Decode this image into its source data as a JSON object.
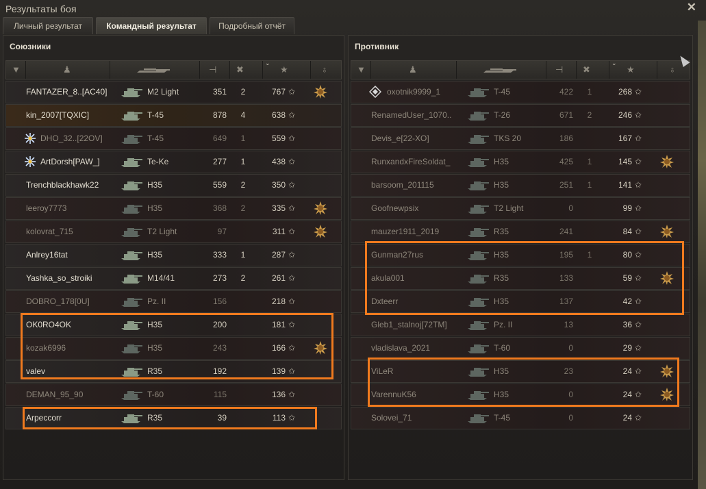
{
  "window": {
    "title": "Результаты боя",
    "close_label": "✕"
  },
  "tabs": [
    {
      "label": "Личный результат",
      "active": false
    },
    {
      "label": "Командный результат",
      "active": true
    },
    {
      "label": "Подробный отчёт",
      "active": false
    }
  ],
  "allies": {
    "title": "Союзники",
    "rows": [
      {
        "name": "FANTAZER_8..[AC40]",
        "vehicle": "M2 Light",
        "damage": "351",
        "kills": "2",
        "xp": "767",
        "alive": true,
        "medal": true,
        "badge": "",
        "player": false
      },
      {
        "name": "kin_2007[TQXIC]",
        "vehicle": "T-45",
        "damage": "878",
        "kills": "4",
        "xp": "638",
        "alive": true,
        "medal": false,
        "badge": "",
        "player": true
      },
      {
        "name": "DHO_32..[22OV]",
        "vehicle": "T-45",
        "damage": "649",
        "kills": "1",
        "xp": "559",
        "alive": false,
        "medal": false,
        "badge": "snowflake",
        "player": false
      },
      {
        "name": "ArtDorsh[PAW_]",
        "vehicle": "Te-Ke",
        "damage": "277",
        "kills": "1",
        "xp": "438",
        "alive": true,
        "medal": false,
        "badge": "snowflake",
        "player": false
      },
      {
        "name": "Trenchblackhawk22",
        "vehicle": "H35",
        "damage": "559",
        "kills": "2",
        "xp": "350",
        "alive": true,
        "medal": false,
        "badge": "",
        "player": false
      },
      {
        "name": "leeroy7773",
        "vehicle": "H35",
        "damage": "368",
        "kills": "2",
        "xp": "335",
        "alive": false,
        "medal": true,
        "badge": "",
        "player": false
      },
      {
        "name": "kolovrat_715",
        "vehicle": "T2 Light",
        "damage": "97",
        "kills": "",
        "xp": "311",
        "alive": false,
        "medal": true,
        "badge": "",
        "player": false
      },
      {
        "name": "Anlrey16tat",
        "vehicle": "H35",
        "damage": "333",
        "kills": "1",
        "xp": "287",
        "alive": true,
        "medal": false,
        "badge": "",
        "player": false
      },
      {
        "name": "Yashka_so_stroiki",
        "vehicle": "M14/41",
        "damage": "273",
        "kills": "2",
        "xp": "261",
        "alive": true,
        "medal": false,
        "badge": "",
        "player": false
      },
      {
        "name": "DOBRO_178[0U]",
        "vehicle": "Pz. II",
        "damage": "156",
        "kills": "",
        "xp": "218",
        "alive": false,
        "medal": false,
        "badge": "",
        "player": false
      },
      {
        "name": "OK0RO4OK",
        "vehicle": "H35",
        "damage": "200",
        "kills": "",
        "xp": "181",
        "alive": true,
        "medal": false,
        "badge": "",
        "player": false
      },
      {
        "name": "kozak6996",
        "vehicle": "H35",
        "damage": "243",
        "kills": "",
        "xp": "166",
        "alive": false,
        "medal": true,
        "badge": "",
        "player": false
      },
      {
        "name": "valev",
        "vehicle": "R35",
        "damage": "192",
        "kills": "",
        "xp": "139",
        "alive": true,
        "medal": false,
        "badge": "",
        "player": false
      },
      {
        "name": "DEMAN_95_90",
        "vehicle": "T-60",
        "damage": "115",
        "kills": "",
        "xp": "136",
        "alive": false,
        "medal": false,
        "badge": "",
        "player": false
      },
      {
        "name": "Arpeccorr",
        "vehicle": "R35",
        "damage": "39",
        "kills": "",
        "xp": "113",
        "alive": true,
        "medal": false,
        "badge": "",
        "player": false
      }
    ]
  },
  "enemies": {
    "title": "Противник",
    "rows": [
      {
        "name": "oxotnik9999_1",
        "vehicle": "T-45",
        "damage": "422",
        "kills": "1",
        "xp": "268",
        "alive": false,
        "medal": false,
        "badge": "diamond"
      },
      {
        "name": "RenamedUser_1070..",
        "vehicle": "T-26",
        "damage": "671",
        "kills": "2",
        "xp": "246",
        "alive": false,
        "medal": false,
        "badge": ""
      },
      {
        "name": "Devis_e[22-XO]",
        "vehicle": "TKS 20",
        "damage": "186",
        "kills": "",
        "xp": "167",
        "alive": false,
        "medal": false,
        "badge": ""
      },
      {
        "name": "RunxandxFireSoldat_",
        "vehicle": "H35",
        "damage": "425",
        "kills": "1",
        "xp": "145",
        "alive": false,
        "medal": true,
        "badge": ""
      },
      {
        "name": "barsoom_201115",
        "vehicle": "H35",
        "damage": "251",
        "kills": "1",
        "xp": "141",
        "alive": false,
        "medal": false,
        "badge": ""
      },
      {
        "name": "Goofnewpsix",
        "vehicle": "T2 Light",
        "damage": "0",
        "kills": "",
        "xp": "99",
        "alive": false,
        "medal": false,
        "badge": ""
      },
      {
        "name": "mauzer1911_2019",
        "vehicle": "R35",
        "damage": "241",
        "kills": "",
        "xp": "84",
        "alive": false,
        "medal": true,
        "badge": ""
      },
      {
        "name": "Gunman27rus",
        "vehicle": "H35",
        "damage": "195",
        "kills": "1",
        "xp": "80",
        "alive": false,
        "medal": false,
        "badge": ""
      },
      {
        "name": "akula001",
        "vehicle": "R35",
        "damage": "133",
        "kills": "",
        "xp": "59",
        "alive": false,
        "medal": true,
        "badge": ""
      },
      {
        "name": "Dxteerr",
        "vehicle": "H35",
        "damage": "137",
        "kills": "",
        "xp": "42",
        "alive": false,
        "medal": false,
        "badge": ""
      },
      {
        "name": "Gleb1_stalnoj[72TM]",
        "vehicle": "Pz. II",
        "damage": "13",
        "kills": "",
        "xp": "36",
        "alive": false,
        "medal": false,
        "badge": ""
      },
      {
        "name": "vladislava_2021",
        "vehicle": "T-60",
        "damage": "0",
        "kills": "",
        "xp": "29",
        "alive": false,
        "medal": false,
        "badge": ""
      },
      {
        "name": "ViLeR",
        "vehicle": "H35",
        "damage": "23",
        "kills": "",
        "xp": "24",
        "alive": false,
        "medal": true,
        "badge": ""
      },
      {
        "name": "VarennuK56",
        "vehicle": "H35",
        "damage": "0",
        "kills": "",
        "xp": "24",
        "alive": false,
        "medal": true,
        "badge": ""
      },
      {
        "name": "Solovei_71",
        "vehicle": "T-45",
        "damage": "0",
        "kills": "",
        "xp": "24",
        "alive": false,
        "medal": false,
        "badge": ""
      }
    ]
  },
  "columns": {
    "icons": [
      "platoon-icon",
      "player-icon",
      "tank-icon",
      "damage-icon",
      "kills-icon",
      "xp-star-icon",
      "medal-icon"
    ],
    "sorted_column": "xp"
  },
  "colors": {
    "highlight": "#f07a1e",
    "player_row": "#3a2a1a"
  }
}
